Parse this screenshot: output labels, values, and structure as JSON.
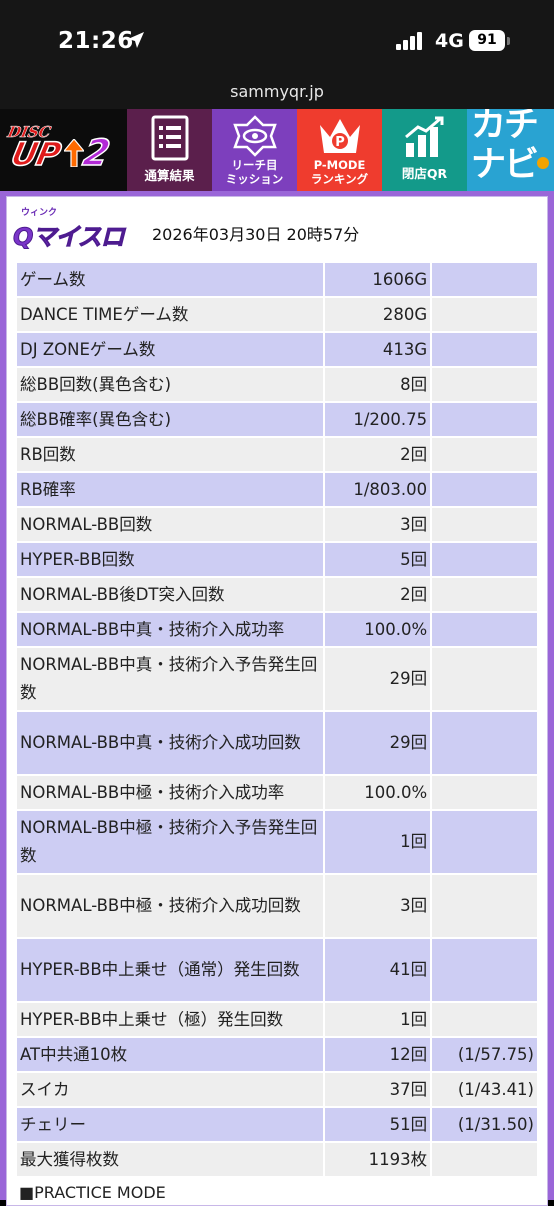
{
  "status": {
    "time": "21:26",
    "network": "4G",
    "battery": "91"
  },
  "url": "sammyqr.jp",
  "nav": {
    "logo": {
      "disc": "DISC",
      "up": "UP",
      "num": "2"
    },
    "items": [
      {
        "label": "通算結果"
      },
      {
        "label1": "リーチ目",
        "label2": "ミッション"
      },
      {
        "label1": "P-MODE",
        "label2": "ランキング"
      },
      {
        "label": "閉店QR"
      },
      {
        "label": "カチナビ"
      }
    ]
  },
  "header": {
    "brand_top": "ウィンク",
    "brand_main": "Qマイスロ",
    "date": "2026年03月30日 20時57分"
  },
  "rows": [
    {
      "label": "ゲーム数",
      "value": "1606G",
      "extra": ""
    },
    {
      "label": "DANCE TIMEゲーム数",
      "value": "280G",
      "extra": ""
    },
    {
      "label": "DJ ZONEゲーム数",
      "value": "413G",
      "extra": ""
    },
    {
      "label": "総BB回数(異色含む)",
      "value": "8回",
      "extra": ""
    },
    {
      "label": "総BB確率(異色含む)",
      "value": "1/200.75",
      "extra": ""
    },
    {
      "label": "RB回数",
      "value": "2回",
      "extra": ""
    },
    {
      "label": "RB確率",
      "value": "1/803.00",
      "extra": ""
    },
    {
      "label": "NORMAL-BB回数",
      "value": "3回",
      "extra": ""
    },
    {
      "label": "HYPER-BB回数",
      "value": "5回",
      "extra": ""
    },
    {
      "label": "NORMAL-BB後DT突入回数",
      "value": "2回",
      "extra": ""
    },
    {
      "label": "NORMAL-BB中真・技術介入成功率",
      "value": "100.0%",
      "extra": ""
    },
    {
      "label": "NORMAL-BB中真・技術介入予告発生回数",
      "value": "29回",
      "extra": ""
    },
    {
      "label": "NORMAL-BB中真・技術介入成功回数",
      "value": "29回",
      "extra": ""
    },
    {
      "label": "NORMAL-BB中極・技術介入成功率",
      "value": "100.0%",
      "extra": ""
    },
    {
      "label": "NORMAL-BB中極・技術介入予告発生回数",
      "value": "1回",
      "extra": ""
    },
    {
      "label": "NORMAL-BB中極・技術介入成功回数",
      "value": "3回",
      "extra": ""
    },
    {
      "label": "HYPER-BB中上乗せ（通常）発生回数",
      "value": "41回",
      "extra": ""
    },
    {
      "label": "HYPER-BB中上乗せ（極）発生回数",
      "value": "1回",
      "extra": ""
    },
    {
      "label": "AT中共通10枚",
      "value": "12回",
      "extra": "(1/57.75)"
    },
    {
      "label": "スイカ",
      "value": "37回",
      "extra": "(1/43.41)"
    },
    {
      "label": "チェリー",
      "value": "51回",
      "extra": "(1/31.50)"
    },
    {
      "label": "最大獲得枚数",
      "value": "1193枚",
      "extra": ""
    }
  ],
  "section_next": "■PRACTICE MODE",
  "colors": {
    "row_odd": "#cdcdf3",
    "row_even": "#eeeeee",
    "frame": "#9a66d8",
    "nav_1": "#5b1f4c",
    "nav_2": "#7d3fbd",
    "nav_3": "#ef3c2e",
    "nav_4": "#139a8a",
    "nav_5": "#29a3d2"
  }
}
